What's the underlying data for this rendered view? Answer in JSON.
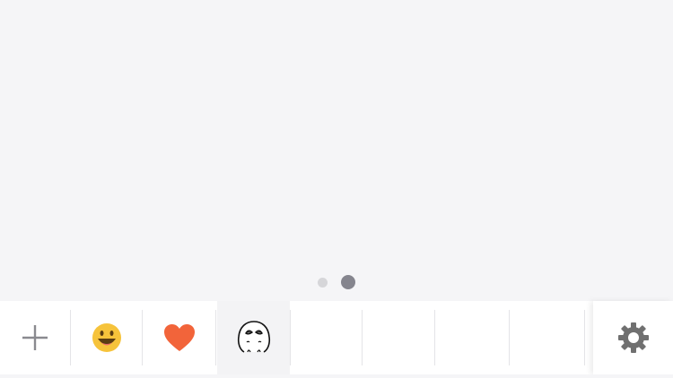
{
  "pager": {
    "page_count": 2,
    "current_page": 2
  },
  "toolbar": {
    "tabs": [
      {
        "icon": "plus-icon",
        "selected": false
      },
      {
        "icon": "smiley-emoji-icon",
        "selected": false
      },
      {
        "icon": "heart-icon",
        "selected": false
      },
      {
        "icon": "sticker-face-icon",
        "selected": true
      },
      {
        "icon": "",
        "selected": false
      },
      {
        "icon": "",
        "selected": false
      },
      {
        "icon": "",
        "selected": false
      },
      {
        "icon": "",
        "selected": false
      }
    ],
    "settings_icon": "gear-icon"
  },
  "colors": {
    "panel_background": "#f5f5f7",
    "toolbar_background": "#ffffff",
    "selected_tab_background": "#f3f3f5",
    "active_dot": "#85858e",
    "inactive_dot": "#d6d6d9",
    "smiley_yellow": "#f6c33b",
    "heart_orange": "#f2643a",
    "gear_gray": "#707070"
  }
}
